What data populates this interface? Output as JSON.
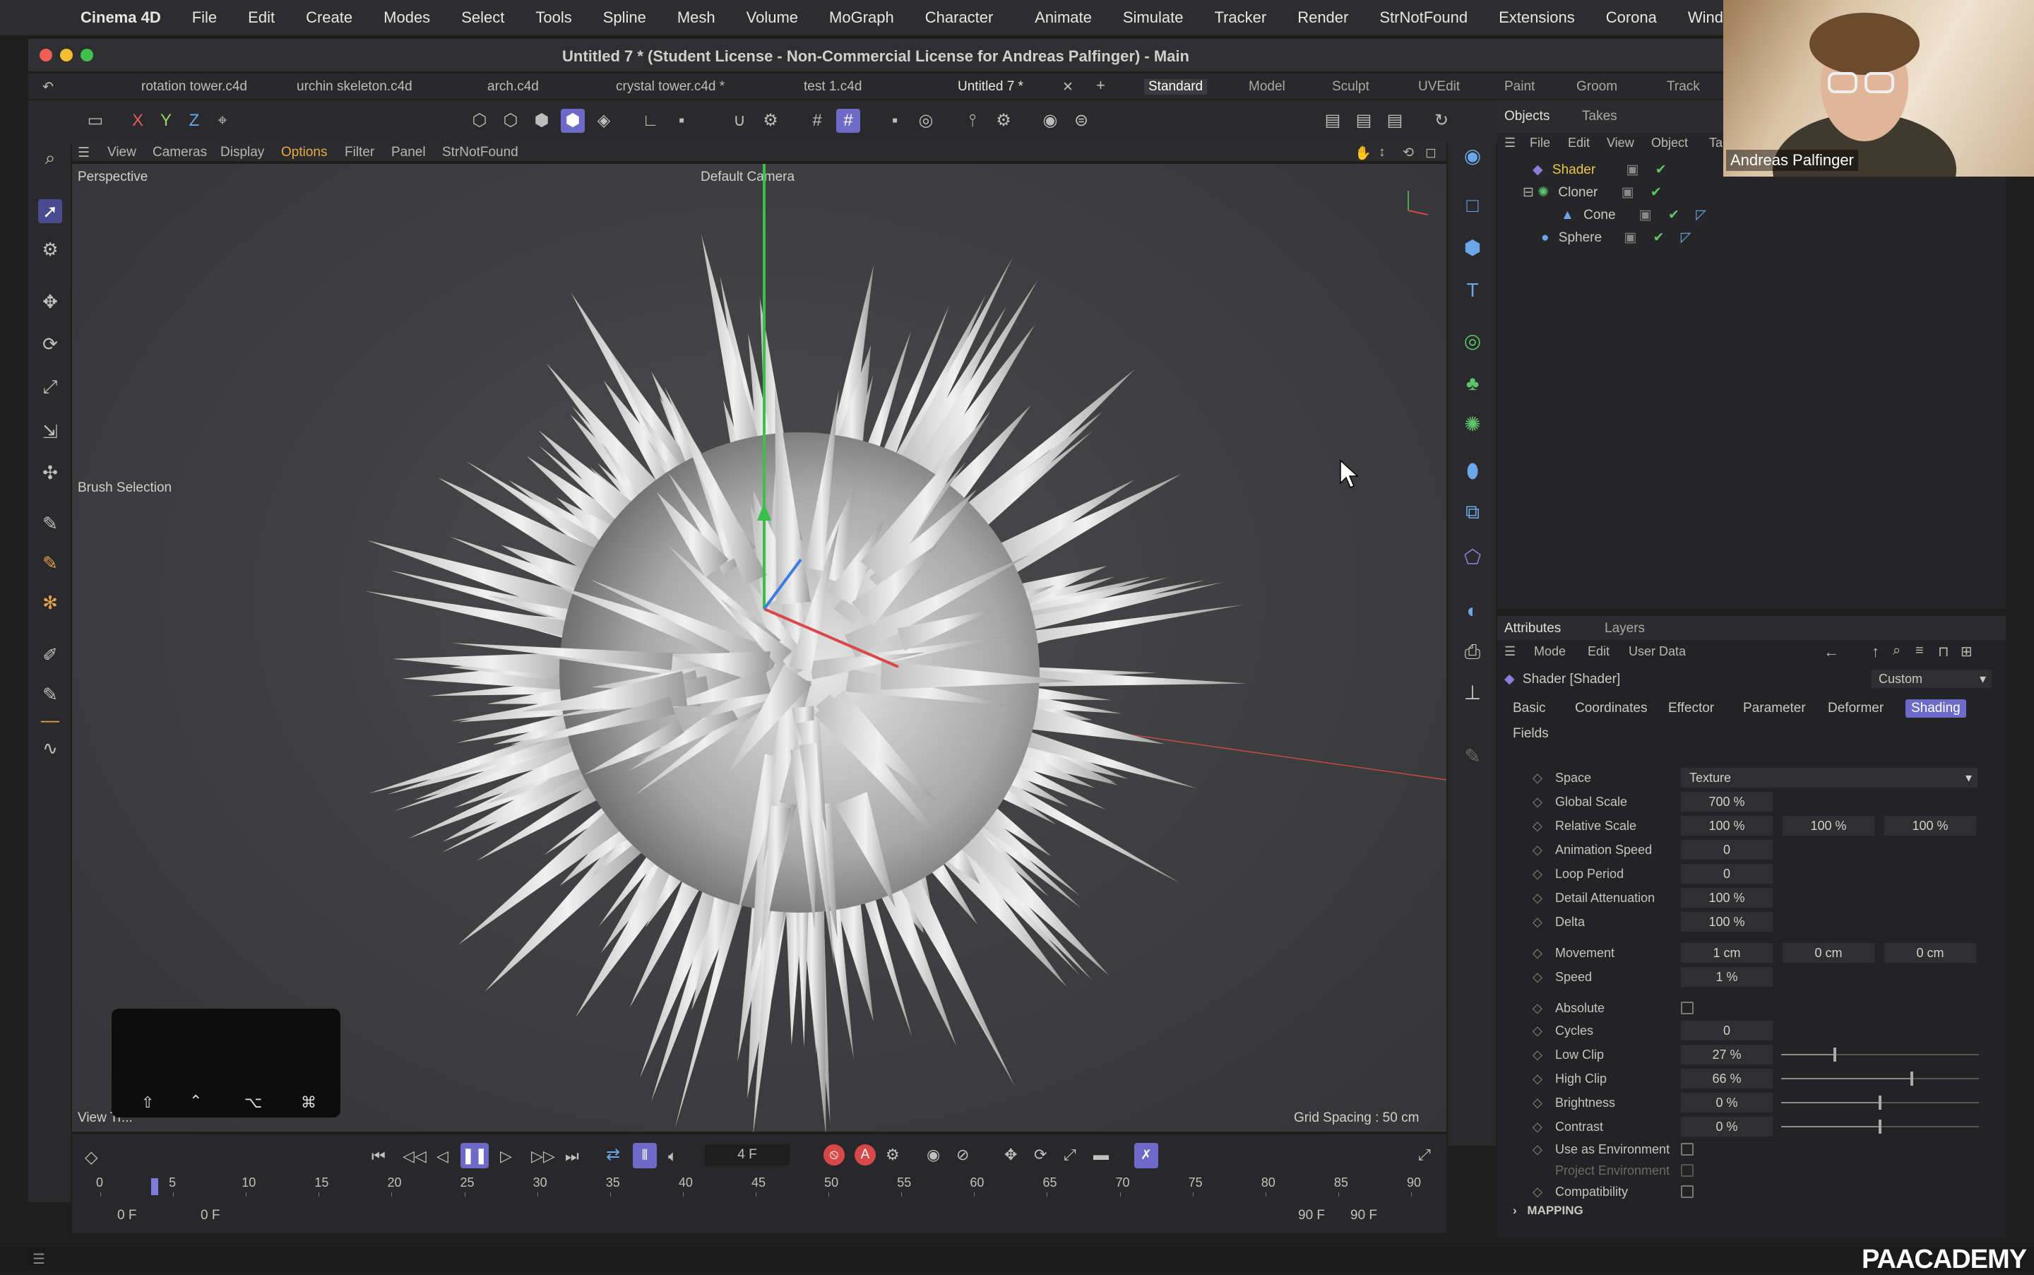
{
  "menubar": {
    "app": "Cinema 4D",
    "items": [
      "File",
      "Edit",
      "Create",
      "Modes",
      "Select",
      "Tools",
      "Spline",
      "Mesh",
      "Volume",
      "MoGraph",
      "Character"
    ],
    "right_items": [
      "Animate",
      "Simulate",
      "Tracker",
      "Render",
      "StrNotFound",
      "Extensions",
      "Corona",
      "Wind"
    ]
  },
  "window": {
    "title": "Untitled 7 * (Student License - Non-Commercial License for Andreas Palfinger) - Main"
  },
  "doc_tabs": [
    "rotation tower.c4d",
    "urchin skeleton.c4d",
    "arch.c4d",
    "crystal tower.c4d *",
    "test 1.c4d",
    "Untitled 7 *"
  ],
  "layouts": [
    "Standard",
    "Model",
    "Sculpt",
    "UVEdit",
    "Paint",
    "Groom",
    "Track"
  ],
  "axis": {
    "x": "X",
    "y": "Y",
    "z": "Z"
  },
  "viewport": {
    "menus": [
      "View",
      "Cameras",
      "Display",
      "Options",
      "Filter",
      "Panel",
      "StrNotFound"
    ],
    "name": "Perspective",
    "camera": "Default Camera",
    "brush_label": "Brush Selection",
    "grid_spacing": "Grid Spacing : 50 cm",
    "hint": "View Tr..."
  },
  "objects": {
    "tabs": [
      "Objects",
      "Takes"
    ],
    "menu": [
      "File",
      "Edit",
      "View",
      "Object",
      "Ta"
    ],
    "tree": [
      {
        "name": "Shader",
        "color": "#e8c64a"
      },
      {
        "name": "Cloner",
        "color": "#c8c8c8"
      },
      {
        "name": "Cone",
        "color": "#c8c8c8"
      },
      {
        "name": "Sphere",
        "color": "#c8c8c8"
      }
    ]
  },
  "attributes": {
    "tabs": [
      "Attributes",
      "Layers"
    ],
    "menu": [
      "Mode",
      "Edit",
      "User Data"
    ],
    "object": "Shader [Shader]",
    "preset": "Custom",
    "subtabs": [
      "Basic",
      "Coordinates",
      "Effector",
      "Parameter",
      "Deformer",
      "Shading",
      "Fields"
    ],
    "rows": {
      "space": {
        "label": "Space",
        "value": "Texture"
      },
      "global_scale": {
        "label": "Global Scale",
        "value": "700 %"
      },
      "relative_scale": {
        "label": "Relative Scale",
        "v1": "100 %",
        "v2": "100 %",
        "v3": "100 %"
      },
      "anim_speed": {
        "label": "Animation Speed",
        "value": "0"
      },
      "loop_period": {
        "label": "Loop Period",
        "value": "0"
      },
      "detail_att": {
        "label": "Detail Attenuation",
        "value": "100 %"
      },
      "delta": {
        "label": "Delta",
        "value": "100 %"
      },
      "movement": {
        "label": "Movement",
        "v1": "1 cm",
        "v2": "0 cm",
        "v3": "0 cm"
      },
      "speed": {
        "label": "Speed",
        "value": "1 %"
      },
      "absolute": {
        "label": "Absolute"
      },
      "cycles": {
        "label": "Cycles",
        "value": "0"
      },
      "low_clip": {
        "label": "Low Clip",
        "value": "27 %",
        "level": 0.27
      },
      "high_clip": {
        "label": "High Clip",
        "value": "66 %",
        "level": 0.66
      },
      "brightness": {
        "label": "Brightness",
        "value": "0 %",
        "level": 0.5
      },
      "contrast": {
        "label": "Contrast",
        "value": "0 %",
        "level": 0.5
      },
      "use_env": {
        "label": "Use as Environment"
      },
      "project_env": {
        "label": "Project Environment"
      },
      "compat": {
        "label": "Compatibility"
      }
    },
    "section": "MAPPING"
  },
  "timeline": {
    "frame": "4 F",
    "ticks": [
      "0",
      "5",
      "10",
      "15",
      "20",
      "25",
      "30",
      "35",
      "40",
      "45",
      "50",
      "55",
      "60",
      "65",
      "70",
      "75",
      "80",
      "85",
      "90"
    ],
    "start": "0 F",
    "start2": "0 F",
    "end": "90 F",
    "end2": "90 F"
  },
  "webcam": {
    "name": "Andreas Palfinger"
  },
  "watermark": "PAACADEMY",
  "colors": {
    "accent": "#6e6bc8",
    "active_menu": "#e5a94a"
  }
}
